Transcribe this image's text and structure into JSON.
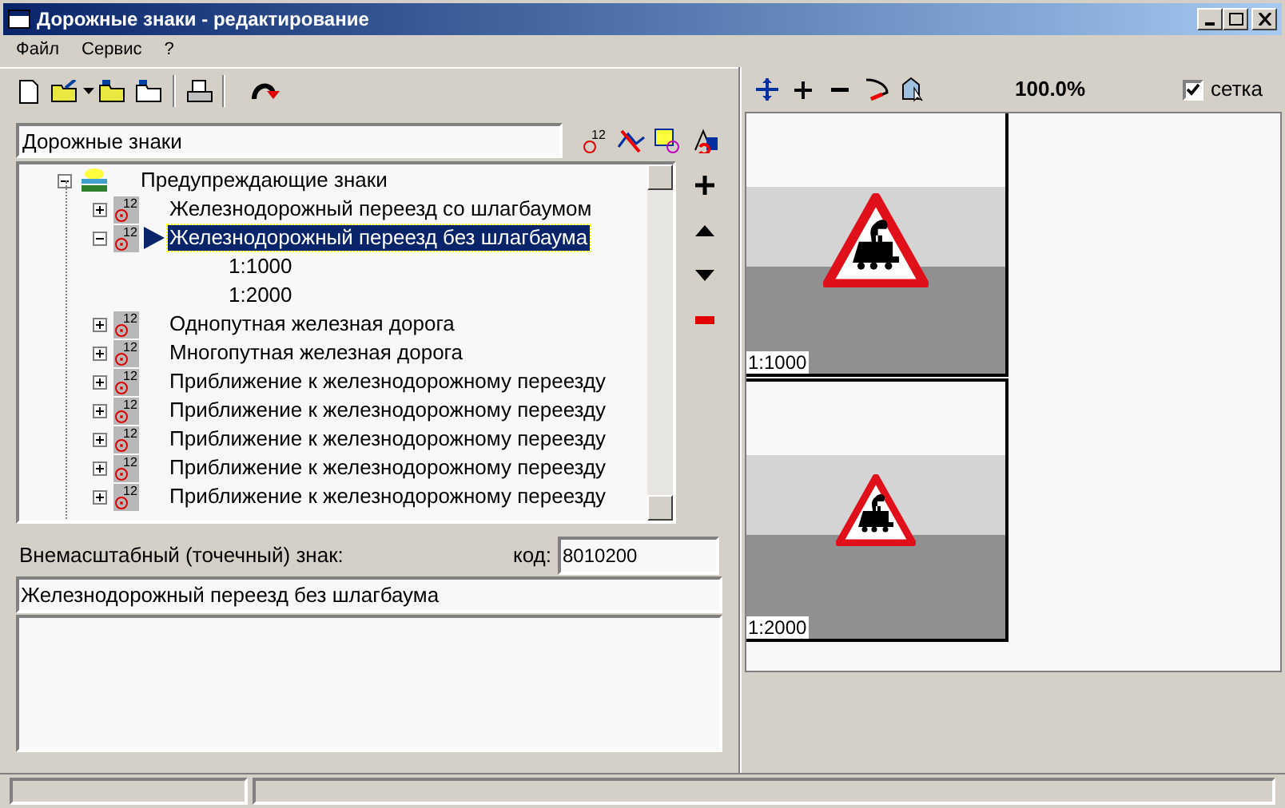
{
  "window": {
    "title": "Дорожные знаки - редактирование"
  },
  "menu": [
    "Файл",
    "Сервис",
    "?"
  ],
  "catalog": {
    "value": "Дорожные знаки",
    "sign_mode_badge": "12"
  },
  "tree": [
    {
      "label": "Предупреждающие знаки",
      "kind": "group",
      "expanded": true,
      "selected": false,
      "children": [
        {
          "label": "Железнодорожный переезд со шлагбаумом",
          "kind": "sign",
          "badge": "12",
          "expanded": false,
          "selected": false
        },
        {
          "label": "Железнодорожный переезд без шлагбаума",
          "kind": "sign",
          "badge": "12",
          "expanded": true,
          "selected": true,
          "children": [
            {
              "label": "1:1000",
              "kind": "scale",
              "selected": false
            },
            {
              "label": "1:2000",
              "kind": "scale",
              "selected": false
            }
          ]
        },
        {
          "label": "Однопутная железная дорога",
          "kind": "sign",
          "badge": "12",
          "expanded": false,
          "selected": false
        },
        {
          "label": "Многопутная железная дорога",
          "kind": "sign",
          "badge": "12",
          "expanded": false,
          "selected": false
        },
        {
          "label": "Приближение к железнодорожному переезду",
          "kind": "sign",
          "badge": "12",
          "expanded": false,
          "selected": false
        },
        {
          "label": "Приближение к железнодорожному переезду",
          "kind": "sign",
          "badge": "12",
          "expanded": false,
          "selected": false
        },
        {
          "label": "Приближение к железнодорожному переезду",
          "kind": "sign",
          "badge": "12",
          "expanded": false,
          "selected": false
        },
        {
          "label": "Приближение к железнодорожному переезду",
          "kind": "sign",
          "badge": "12",
          "expanded": false,
          "selected": false
        },
        {
          "label": "Приближение к железнодорожному переезду",
          "kind": "sign",
          "badge": "12",
          "expanded": false,
          "selected": false
        }
      ]
    }
  ],
  "details": {
    "type_label": "Внемасштабный (точечный) знак:",
    "code_label": "код:",
    "code": "8010200",
    "name": "Железнодорожный переезд без шлагбаума"
  },
  "preview": {
    "zoom": "100.0%",
    "grid": {
      "label": "сетка",
      "checked": true
    },
    "cells": [
      {
        "scale": "1:1000"
      },
      {
        "scale": "1:2000"
      }
    ]
  }
}
